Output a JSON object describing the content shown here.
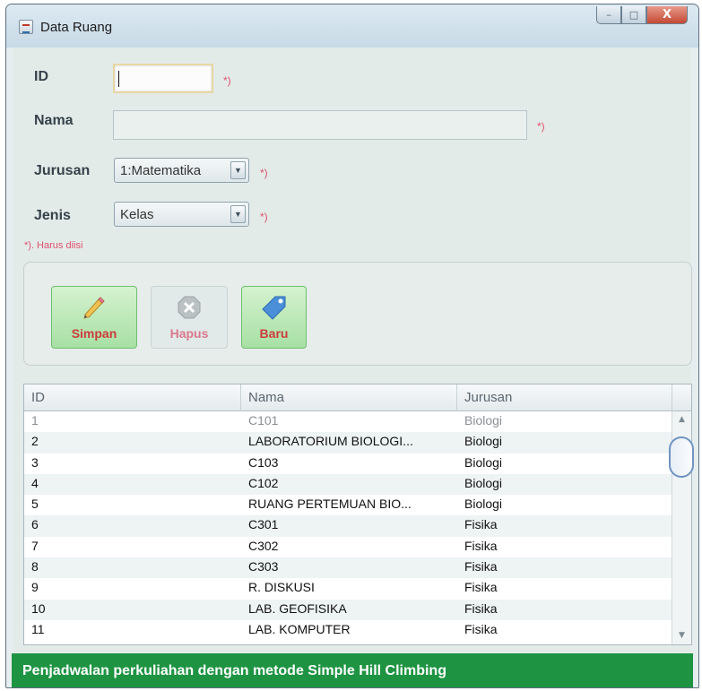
{
  "window": {
    "title": "Data Ruang",
    "icon": "java-cup-icon",
    "controls": {
      "minimize": "–",
      "maximize": "□",
      "close": "X"
    }
  },
  "form": {
    "id_label": "ID",
    "id_value": "",
    "nama_label": "Nama",
    "nama_value": "",
    "jurusan_label": "Jurusan",
    "jurusan_selected": "1:Matematika",
    "jenis_label": "Jenis",
    "jenis_selected": "Kelas",
    "required_mark": "*)",
    "required_note": "*). Harus diisi"
  },
  "buttons": {
    "simpan": "Simpan",
    "hapus": "Hapus",
    "baru": "Baru"
  },
  "table": {
    "columns": [
      "ID",
      "Nama",
      "Jurusan"
    ],
    "rows": [
      [
        "1",
        "C101",
        "Biologi"
      ],
      [
        "2",
        "LABORATORIUM BIOLOGI...",
        "Biologi"
      ],
      [
        "3",
        "C103",
        "Biologi"
      ],
      [
        "4",
        "C102",
        "Biologi"
      ],
      [
        "5",
        "RUANG PERTEMUAN BIO...",
        "Biologi"
      ],
      [
        "6",
        "C301",
        "Fisika"
      ],
      [
        "7",
        "C302",
        "Fisika"
      ],
      [
        "8",
        "C303",
        "Fisika"
      ],
      [
        "9",
        "R. DISKUSI",
        "Fisika"
      ],
      [
        "10",
        "LAB. GEOFISIKA",
        "Fisika"
      ],
      [
        "11",
        "LAB. KOMPUTER",
        "Fisika"
      ]
    ]
  },
  "status_bar": "Penjadwalan perkuliahan dengan metode Simple Hill Climbing",
  "colors": {
    "status_green": "#1e9443",
    "required_red": "#e0506c",
    "button_green": "#a7e0a4"
  }
}
